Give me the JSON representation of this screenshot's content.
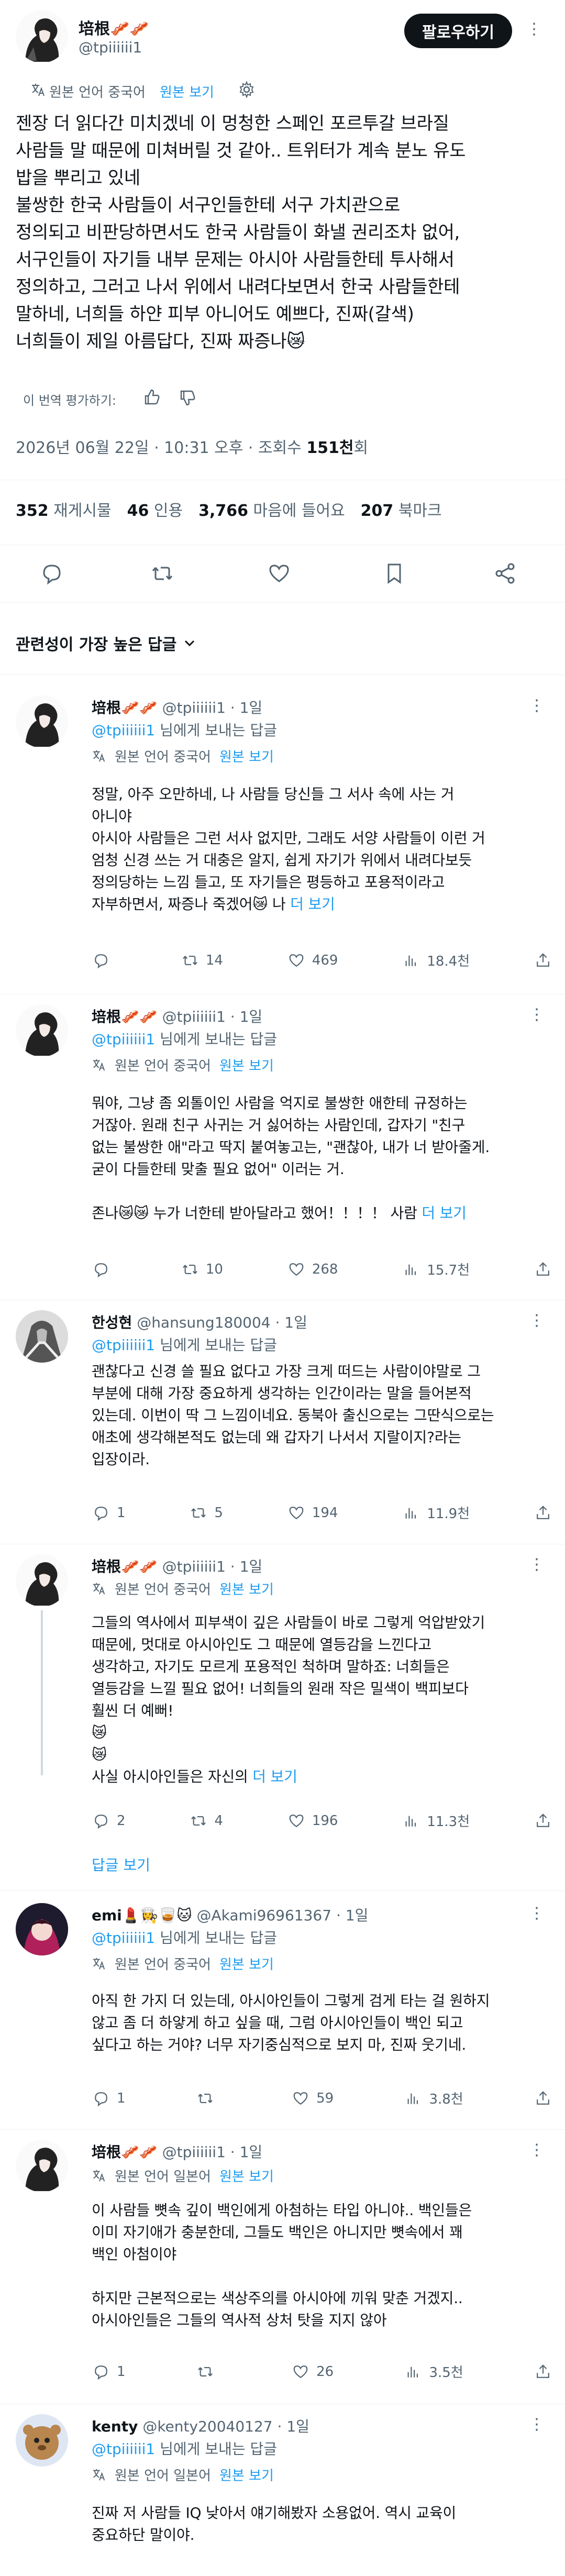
{
  "author": {
    "name": "培根🥓🥓",
    "handle": "@tpiiiiii1",
    "follow_label": "팔로우하기"
  },
  "translation": {
    "source_label": "원본 언어 중국어",
    "view_original": "원본 보기",
    "rate_label": "이 번역 평가하기:"
  },
  "tweet": {
    "lines": [
      "젠장 더 읽다간 미치겠네 이 멍청한 스페인 포르투갈 브라질",
      "사람들 말 때문에 미쳐버릴 것 같아.. 트위터가 계속 분노 유도",
      "밥을 뿌리고 있네",
      "불쌍한 한국 사람들이 서구인들한테 서구 가치관으로",
      "정의되고 비판당하면서도 한국 사람들이 화낼 권리조차 없어,",
      "서구인들이 자기들 내부 문제는 아시아 사람들한테 투사해서",
      "정의하고, 그러고 나서 위에서 내려다보면서 한국 사람들한테",
      "말하네, 너희들 하얀 피부 아니어도 예쁘다, 진짜(갈색)",
      "너희들이 제일 아름답다, 진짜 짜증나😿"
    ],
    "timestamp": "2026년 06월 22일 · 10:31 오후 · 조회수 ",
    "views": "151천",
    "views_suffix": "회"
  },
  "stats": {
    "retweets": "352",
    "retweets_label": "재게시물",
    "quotes": "46",
    "quotes_label": "인용",
    "likes": "3,766",
    "likes_label": "마음에 들어요",
    "bookmarks": "207",
    "bookmarks_label": "북마크"
  },
  "sort_label": "관련성이 가장 높은 답글",
  "show_replies": "답글 보기",
  "replies": [
    {
      "name": "培根🥓🥓",
      "handle": "@tpiiiiii1",
      "time": "· 1일",
      "reply_to": "@tpiiiiii1",
      "reply_to_suffix": " 님에게 보내는 답글",
      "lang": "원본 언어 중국어",
      "view_original": "원본 보기",
      "lines": [
        "정말, 아주 오만하네, 나 사람들 당신들 그 서사 속에 사는 거",
        "아니야",
        "아시아 사람들은 그런 서사 없지만, 그래도 서양 사람들이 이런 거",
        "엄청 신경 쓰는 거 대충은 알지, 쉽게 자기가 위에서 내려다보듯",
        "정의당하는 느낌 들고, 또 자기들은 평등하고 포용적이라고",
        "자부하면서, 짜증나 죽겠어😿 나 "
      ],
      "more": "더 보기",
      "comments": "",
      "retweets": "14",
      "likes": "469",
      "views": "18.4천"
    },
    {
      "name": "培根🥓🥓",
      "handle": "@tpiiiiii1",
      "time": "· 1일",
      "reply_to": "@tpiiiiii1",
      "reply_to_suffix": " 님에게 보내는 답글",
      "lang": "원본 언어 중국어",
      "view_original": "원본 보기",
      "lines": [
        "뭐야, 그냥 좀 외톨이인 사람을 억지로 불쌍한 애한테 규정하는",
        "거잖아. 원래 친구 사귀는 거 싫어하는 사람인데, 갑자기 \"친구",
        "없는 불쌍한 애\"라고 딱지 붙여놓고는, \"괜찮아, 내가 너 받아줄게.",
        "굳이 다들한테 맞출 필요 없어\" 이러는 거.",
        "",
        "존나😿😿 누가 너한테 받아달라고 했어！！！！ 사람 "
      ],
      "more": "더 보기",
      "comments": "",
      "retweets": "10",
      "likes": "268",
      "views": "15.7천"
    },
    {
      "name": "한성현",
      "handle": "@hansung180004",
      "time": "· 1일",
      "reply_to": "@tpiiiiii1",
      "reply_to_suffix": " 님에게 보내는 답글",
      "lines": [
        "괜찮다고 신경 쓸 필요 없다고 가장 크게 떠드는 사람이야말로 그",
        "부분에 대해 가장 중요하게 생각하는 인간이라는 말을 들어본적",
        "있는데. 이번이 딱 그 느낌이네요. 동북아 출신으로는 그딴식으로는",
        "애초에 생각해본적도 없는데 왜 갑자기 나서서 지랄이지?라는",
        "입장이라."
      ],
      "comments": "1",
      "retweets": "5",
      "likes": "194",
      "views": "11.9천"
    },
    {
      "name": "培根🥓🥓",
      "handle": "@tpiiiiii1",
      "time": "· 1일",
      "lang": "원본 언어 중국어",
      "view_original": "원본 보기",
      "lines": [
        "그들의 역사에서 피부색이 깊은 사람들이 바로 그렇게 억압받았기",
        "때문에, 멋대로 아시아인도 그 때문에 열등감을 느낀다고",
        "생각하고, 자기도 모르게 포용적인 척하며 말하죠: 너희들은",
        "열등감을 느낄 필요 없어! 너희들의 원래 작은 밀색이 백피보다",
        "훨씬 더 예뻐!",
        "😿",
        "😿",
        "사실 아시아인들은 자신의 "
      ],
      "more": "더 보기",
      "comments": "2",
      "retweets": "4",
      "likes": "196",
      "views": "11.3천"
    },
    {
      "name": "emi💄👩‍🍳🥃🐱",
      "handle": "@Akami96961367",
      "time": "· 1일",
      "reply_to": "@tpiiiiii1",
      "reply_to_suffix": " 님에게 보내는 답글",
      "lang": "원본 언어 중국어",
      "view_original": "원본 보기",
      "lines": [
        "아직 한 가지 더 있는데, 아시아인들이 그렇게 검게 타는 걸 원하지",
        "않고 좀 더 하얗게 하고 싶을 때, 그럼 아시아인들이 백인 되고",
        "싶다고 하는 거야? 너무 자기중심적으로 보지 마, 진짜 웃기네."
      ],
      "comments": "1",
      "retweets": "",
      "likes": "59",
      "views": "3.8천"
    },
    {
      "name": "培根🥓🥓",
      "handle": "@tpiiiiii1",
      "time": "· 1일",
      "lang": "원본 언어 일본어",
      "view_original": "원본 보기",
      "lines": [
        "이 사람들 뼛속 깊이 백인에게 아첨하는 타입 아니야.. 백인들은",
        "이미 자기애가 충분한데, 그들도 백인은 아니지만 뼛속에서 꽤",
        "백인 아첨이야",
        "",
        "하지만 근본적으로는 색상주의를 아시아에 끼워 맞춘 거겠지..",
        "아시아인들은 그들의 역사적 상처 탓을 지지 않아"
      ],
      "comments": "1",
      "retweets": "",
      "likes": "26",
      "views": "3.5천"
    },
    {
      "name": "kenty",
      "handle": "@kenty20040127",
      "time": "· 1일",
      "reply_to": "@tpiiiiii1",
      "reply_to_suffix": " 님에게 보내는 답글",
      "lang": "원본 언어 일본어",
      "view_original": "원본 보기",
      "lines": [
        "진짜 저 사람들 IQ 낮아서 얘기해봤자 소용없어. 역시 교육이",
        "중요하단 말이야."
      ]
    }
  ],
  "icons": {
    "translate": "translate-icon",
    "settings": "gear-icon",
    "thumbs_up": "thumbs-up-icon",
    "thumbs_down": "thumbs-down-icon",
    "reply": "reply-icon",
    "retweet": "retweet-icon",
    "like": "heart-icon",
    "bookmark": "bookmark-icon",
    "share": "share-icon",
    "views": "bar-chart-icon",
    "more": "more-dots-icon"
  },
  "colors": {
    "text": "#0f1419",
    "secondary": "#536471",
    "link": "#1d9bf0",
    "follow_bg": "#0f1419"
  }
}
